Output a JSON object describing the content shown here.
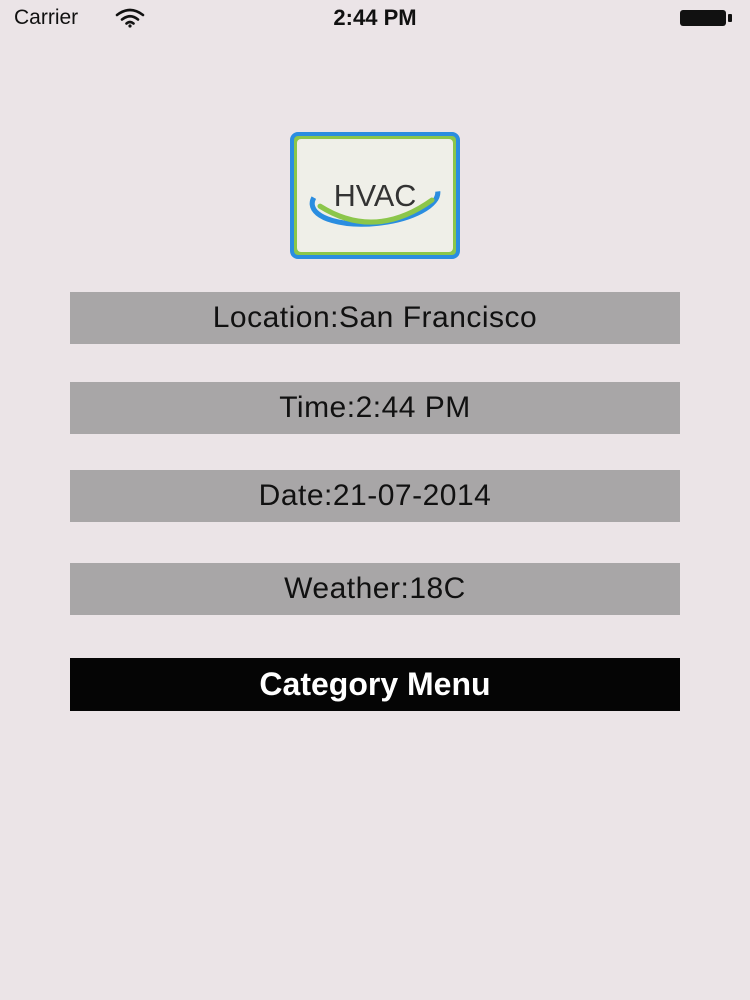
{
  "status_bar": {
    "carrier": "Carrier",
    "time": "2:44 PM",
    "wifi_icon": "wifi-icon",
    "battery_icon": "battery-icon"
  },
  "logo": {
    "text": "HVAC",
    "icon": "hvac-logo"
  },
  "info": {
    "location": "Location:San Francisco",
    "time": "Time:2:44 PM",
    "date": "Date:21-07-2014",
    "weather": "Weather:18C"
  },
  "actions": {
    "category_menu_label": "Category Menu"
  },
  "colors": {
    "background": "#ebe4e7",
    "info_row_bg": "#a8a6a7",
    "button_bg": "#050505",
    "button_text": "#ffffff",
    "logo_border_blue": "#2a8de0",
    "logo_border_green": "#8bc64a"
  }
}
